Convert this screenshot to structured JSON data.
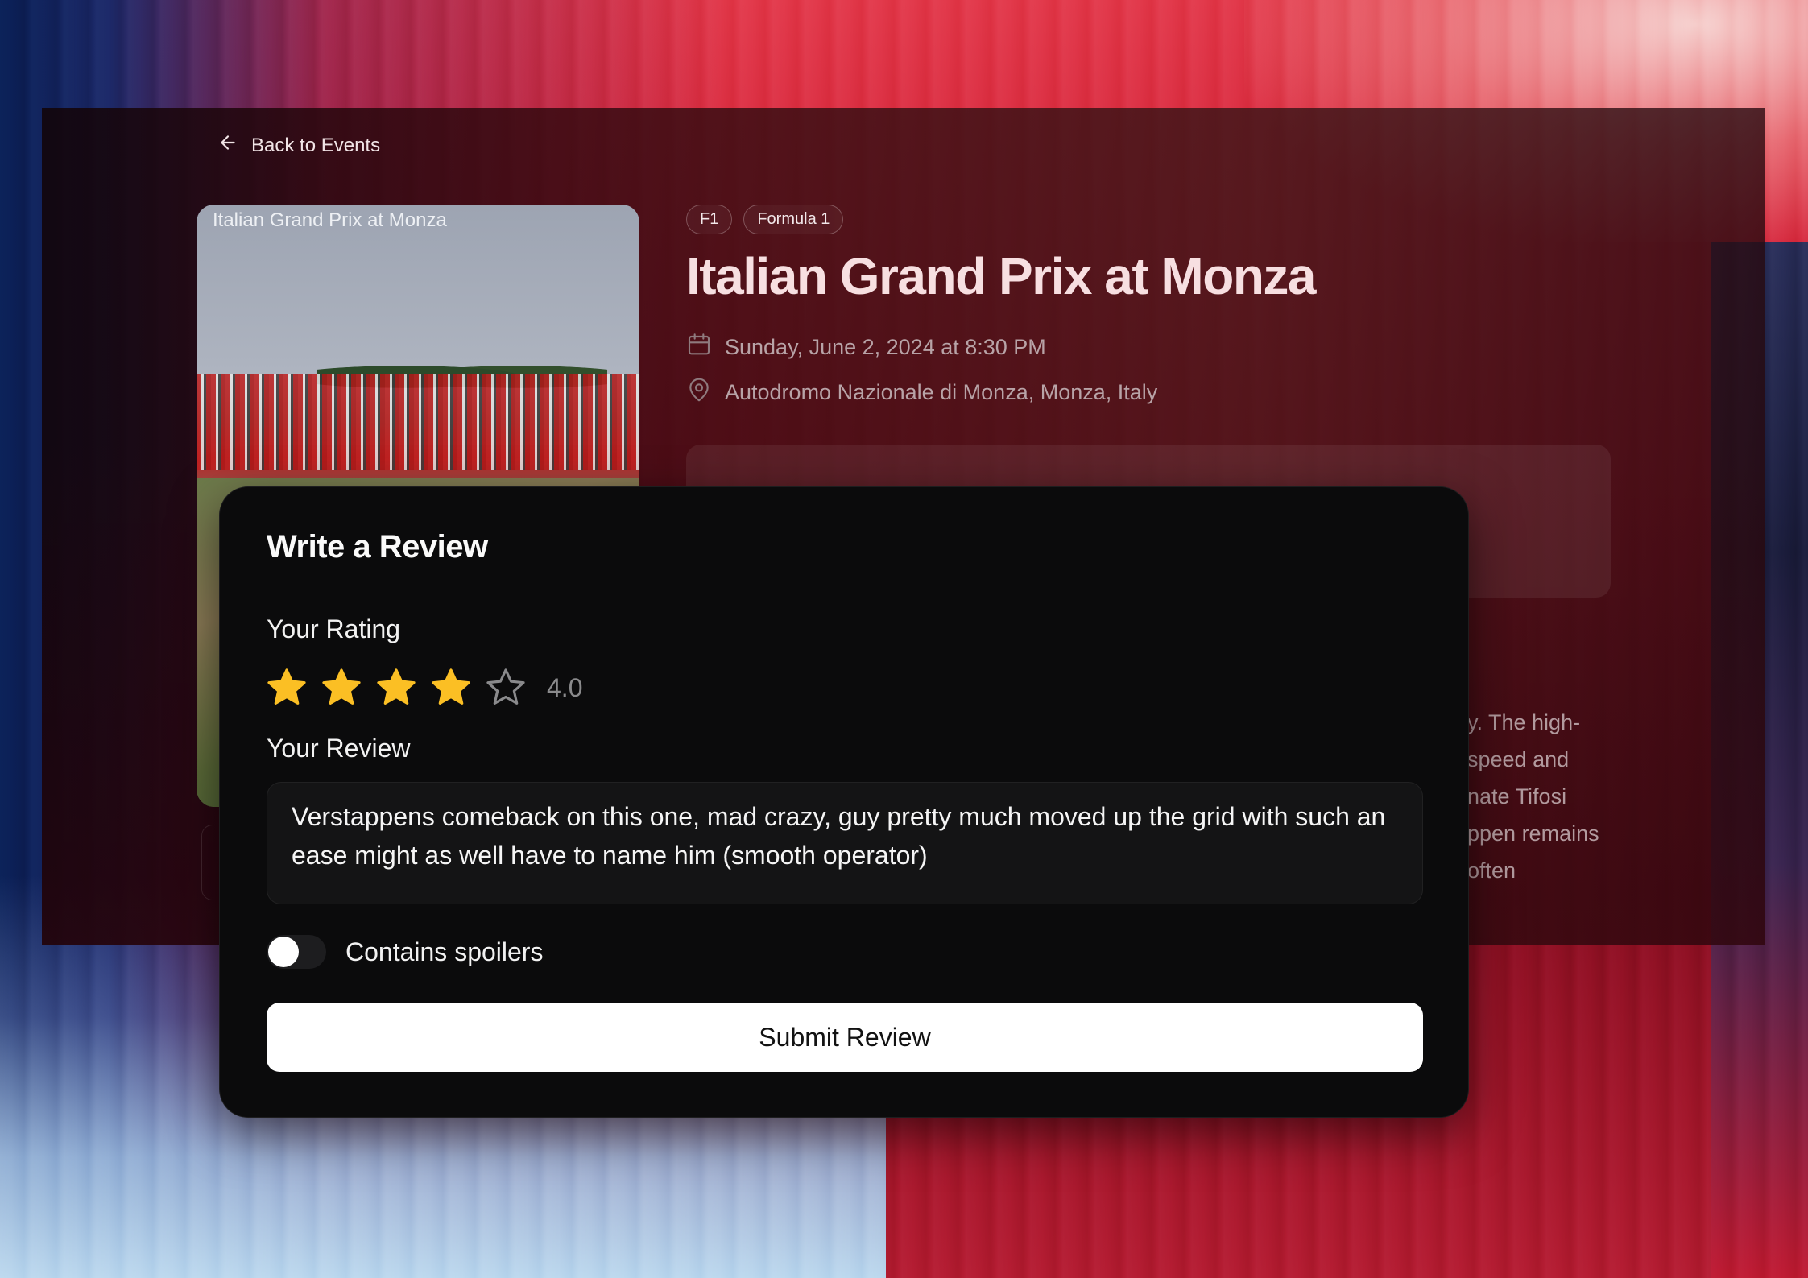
{
  "nav": {
    "back_label": "Back to Events"
  },
  "event": {
    "image_alt": "Italian Grand Prix at Monza",
    "tags": [
      "F1",
      "Formula 1"
    ],
    "title": "Italian Grand Prix at Monza",
    "date": "Sunday, June 2, 2024 at 8:30 PM",
    "location": "Autodromo Nazionale di Monza, Monza, Italy",
    "description_fragments": [
      "y. The high-",
      "speed and",
      "nate Tifosi",
      "ppen remains",
      "often"
    ]
  },
  "review": {
    "title": "Write a Review",
    "rating_label": "Your Rating",
    "rating": 4,
    "rating_max": 5,
    "rating_display": "4.0",
    "review_label": "Your Review",
    "review_text": "Verstappens comeback on this one, mad crazy, guy pretty much moved up the grid with such an ease might as well have to name him (smooth operator)",
    "spoiler_label": "Contains spoilers",
    "spoiler_on": false,
    "submit_label": "Submit Review"
  },
  "colors": {
    "star_filled": "#fbbf24",
    "star_empty": "#8a8a8c",
    "modal_bg": "#0b0b0c",
    "accent_title": "#f7dfe1"
  }
}
